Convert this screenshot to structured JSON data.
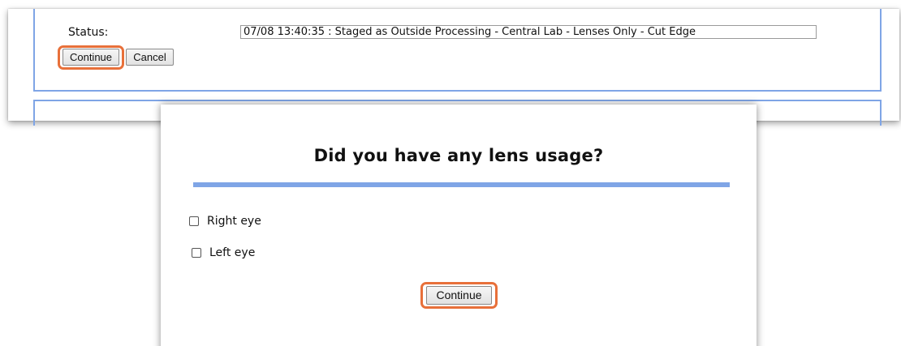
{
  "form": {
    "status_label": "Status:",
    "status_value": "07/08 13:40:35 : Staged as Outside Processing - Central Lab - Lenses Only - Cut Edge",
    "continue_label": "Continue",
    "cancel_label": "Cancel"
  },
  "modal": {
    "title": "Did you have any lens usage?",
    "options": [
      {
        "label": "Right eye",
        "checked": false
      },
      {
        "label": "Left eye",
        "checked": false
      }
    ],
    "continue_label": "Continue"
  },
  "colors": {
    "frame_border": "#7fa5e6",
    "highlight": "#e8703a"
  }
}
